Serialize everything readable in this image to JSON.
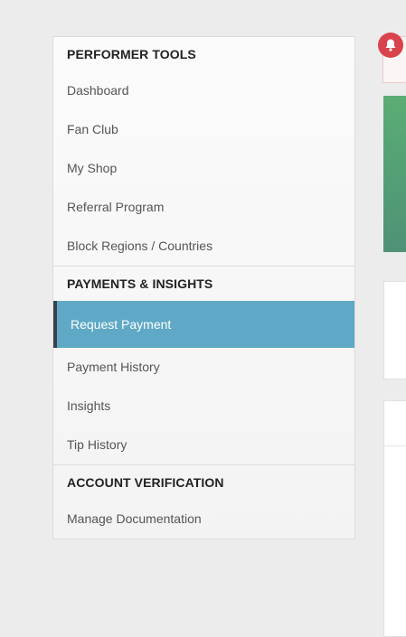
{
  "sidebar": {
    "sections": [
      {
        "header": "PERFORMER TOOLS",
        "items": [
          "Dashboard",
          "Fan Club",
          "My Shop",
          "Referral Program",
          "Block Regions / Countries"
        ]
      },
      {
        "header": "PAYMENTS & INSIGHTS",
        "items": [
          "Request Payment",
          "Payment History",
          "Insights",
          "Tip History"
        ],
        "active_item": "Request Payment"
      },
      {
        "header": "ACCOUNT VERIFICATION",
        "items": [
          "Manage Documentation"
        ]
      }
    ]
  },
  "colors": {
    "active_bg": "#5fa9c6",
    "active_border": "#3a3f4a",
    "notification": "#d9434b",
    "green_card": "#5aad74"
  },
  "icons": {
    "notification": "bell-icon"
  }
}
